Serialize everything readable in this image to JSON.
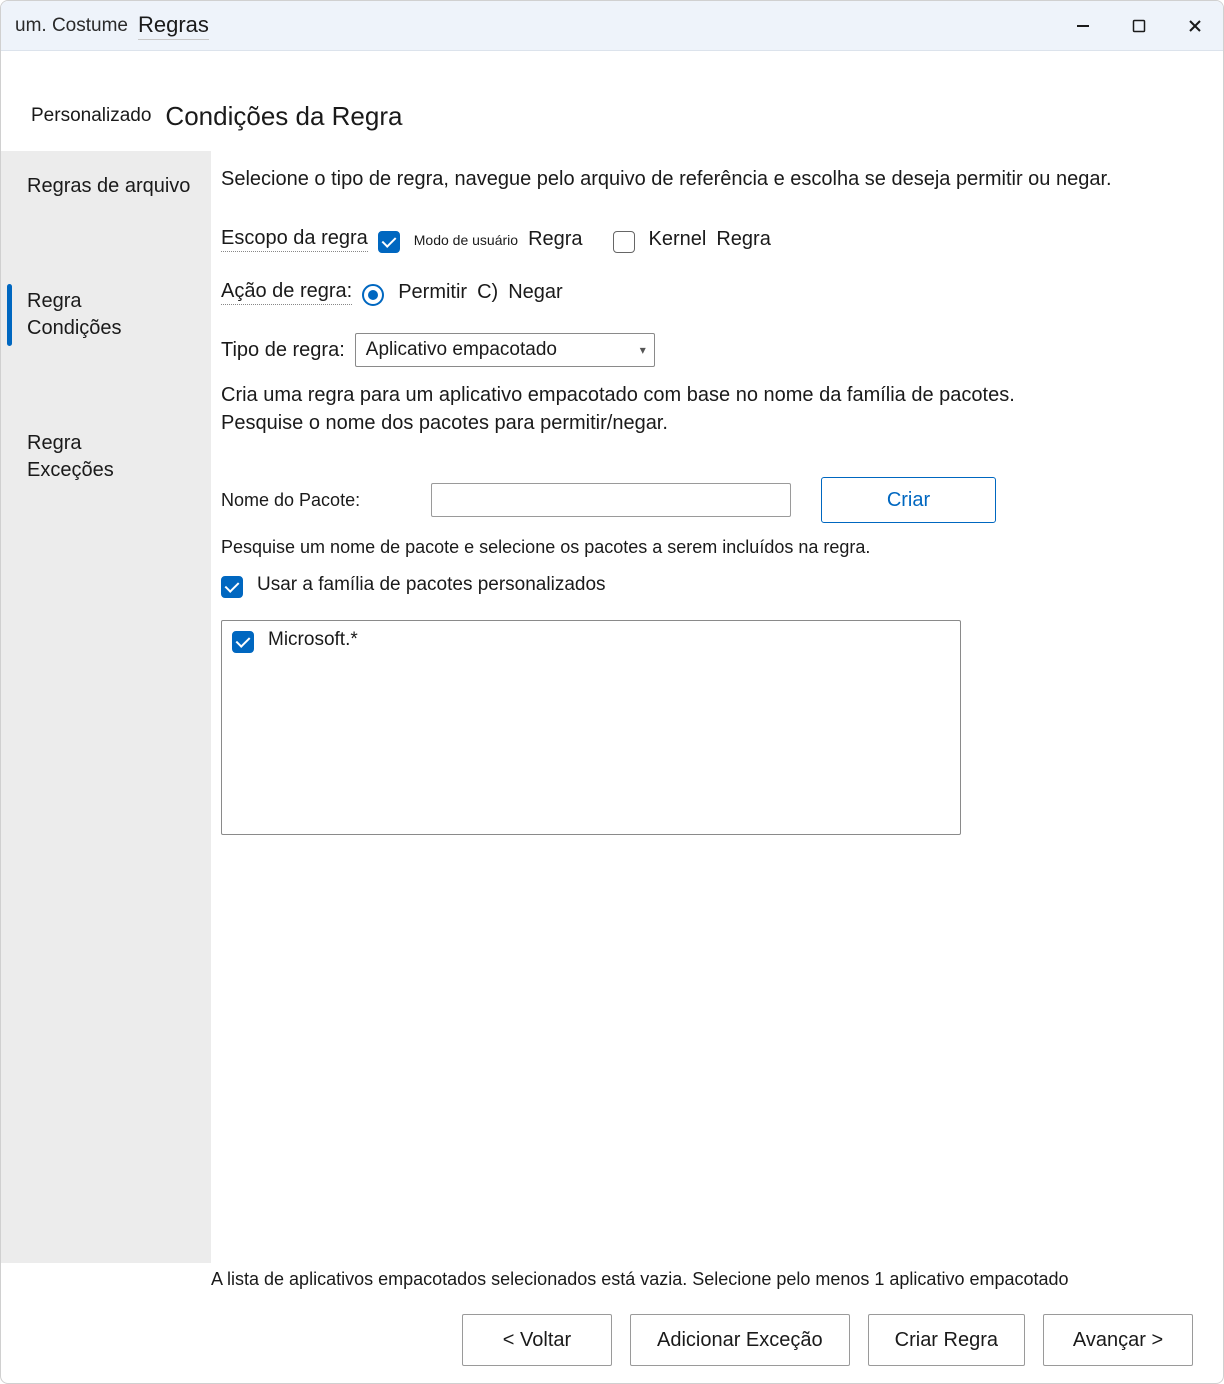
{
  "window": {
    "app_title": "um. Costume",
    "page_title": "Regras"
  },
  "header": {
    "crumb": "Personalizado",
    "title": "Condições da Regra"
  },
  "sidebar": {
    "items": [
      {
        "label": "Regras de arquivo",
        "active": false
      },
      {
        "label": "Regra\nCondições",
        "active": true
      },
      {
        "label": "Regra\nExceções",
        "active": false
      }
    ]
  },
  "main": {
    "intro": "Selecione o tipo de regra, navegue pelo arquivo de referência e escolha se deseja permitir ou negar.",
    "scope": {
      "label": "Escopo da regra",
      "opt1": "Modo de usuário",
      "suffix1": "Regra",
      "opt2": "Kernel",
      "suffix2": "Regra"
    },
    "action": {
      "label": "Ação de regra:",
      "allow": "Permitir",
      "deny_prefix": "C)",
      "deny": "Negar"
    },
    "ruletype": {
      "label": "Tipo de regra:",
      "value": "Aplicativo empacotado"
    },
    "desc": "Cria uma regra para um aplicativo empacotado com base no nome da família de pacotes. Pesquise o nome dos pacotes para permitir/negar.",
    "package": {
      "label": "Nome do Pacote:",
      "value": "",
      "button": "Criar",
      "hint": "Pesquise um nome de pacote e selecione os pacotes a serem incluídos na regra.",
      "use_custom_family": "Usar a família de pacotes personalizados",
      "list": [
        {
          "checked": true,
          "name": "Microsoft.*"
        }
      ]
    }
  },
  "footer": {
    "warning": "A lista de aplicativos empacotados selecionados está vazia. Selecione pelo menos 1 aplicativo empacotado",
    "btn_back": "<  Voltar",
    "btn_addexc": "Adicionar Exceção",
    "btn_create": "Criar Regra",
    "btn_next": "Avançar >"
  }
}
